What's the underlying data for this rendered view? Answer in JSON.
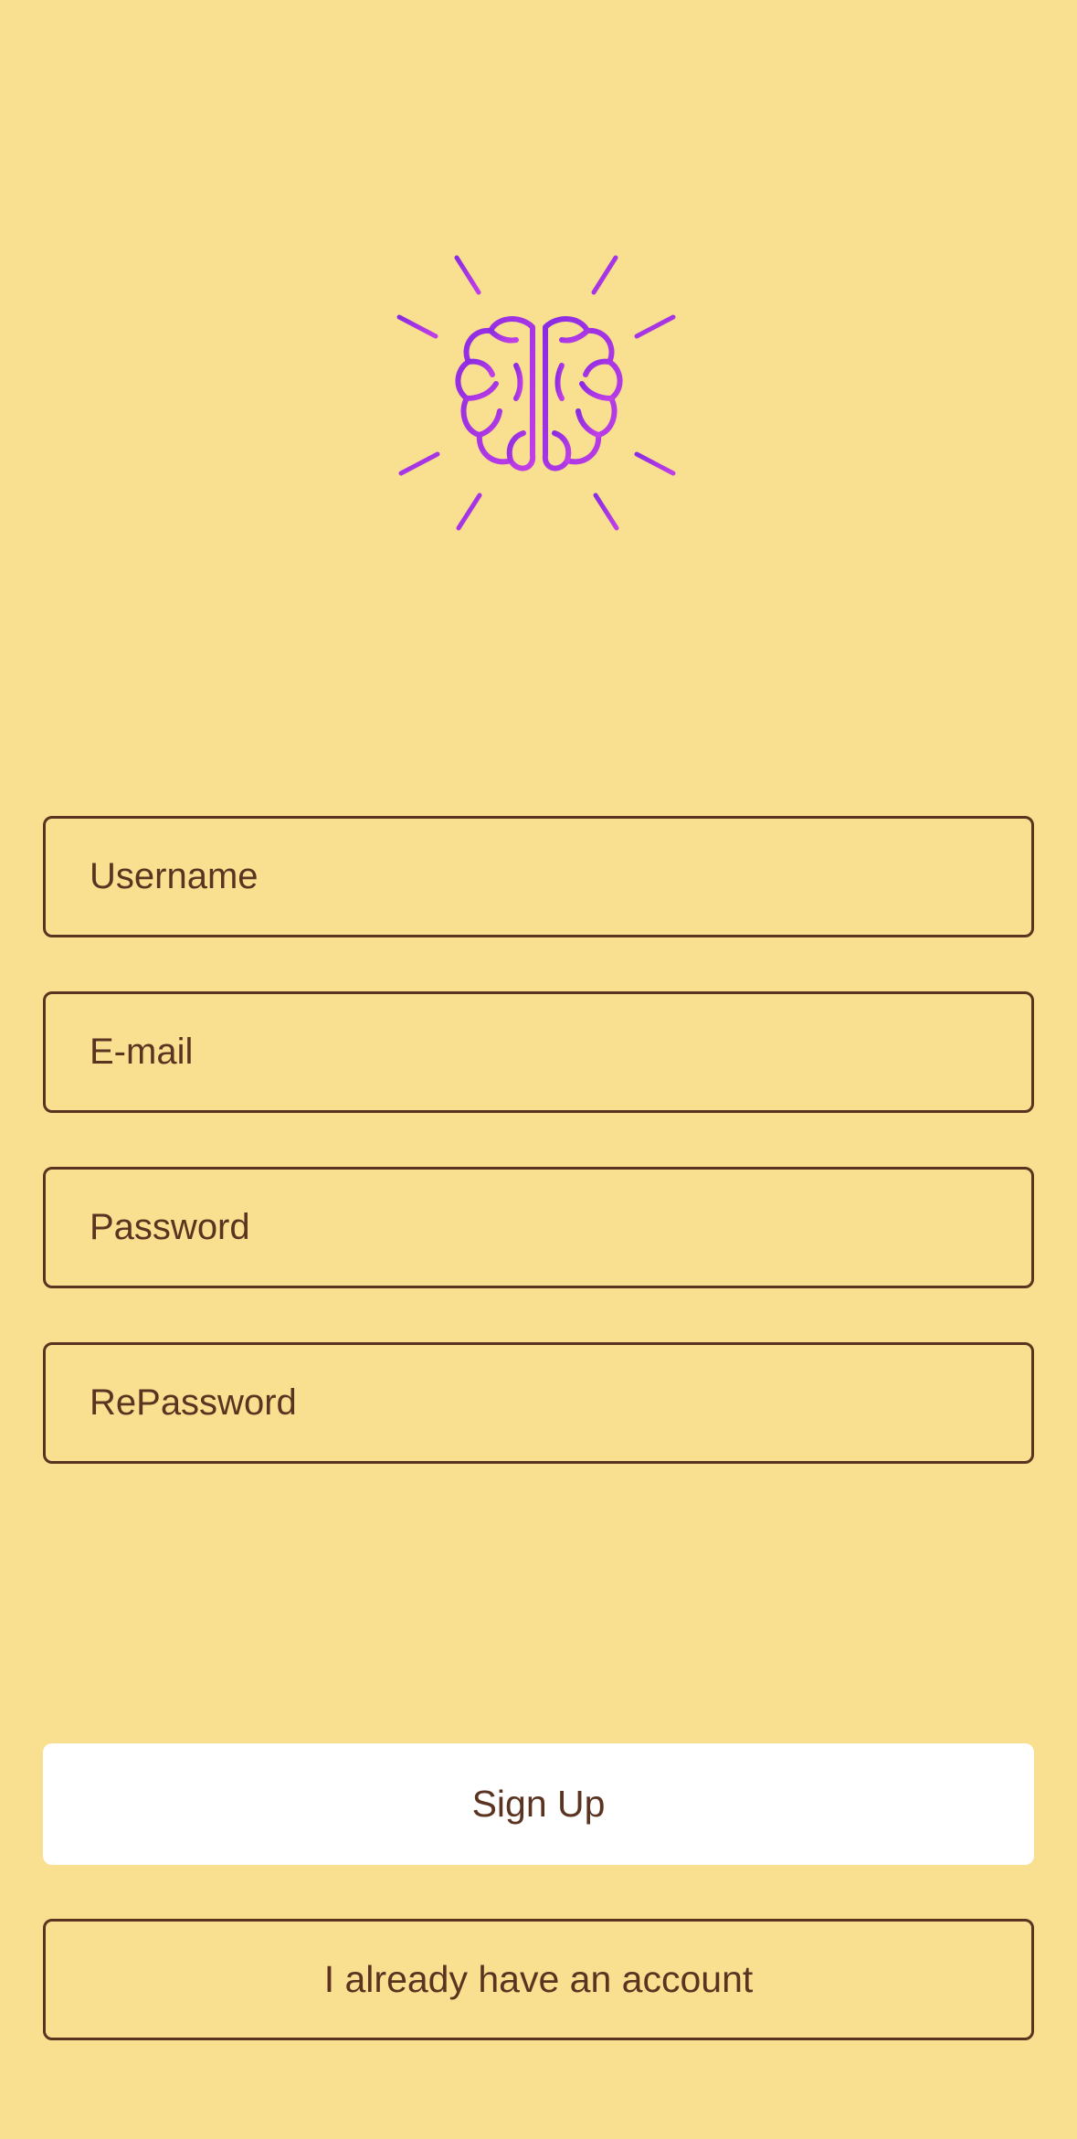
{
  "logo": {
    "icon": "brain-idea-icon",
    "color": "#A726E8"
  },
  "form": {
    "username_placeholder": "Username",
    "email_placeholder": "E-mail",
    "password_placeholder": "Password",
    "repassword_placeholder": "RePassword"
  },
  "actions": {
    "signup_label": "Sign Up",
    "login_label": "I already have an account"
  },
  "colors": {
    "background": "#F9E090",
    "text": "#5A3321",
    "primary_button": "#FFFFFF",
    "accent": "#A726E8"
  }
}
